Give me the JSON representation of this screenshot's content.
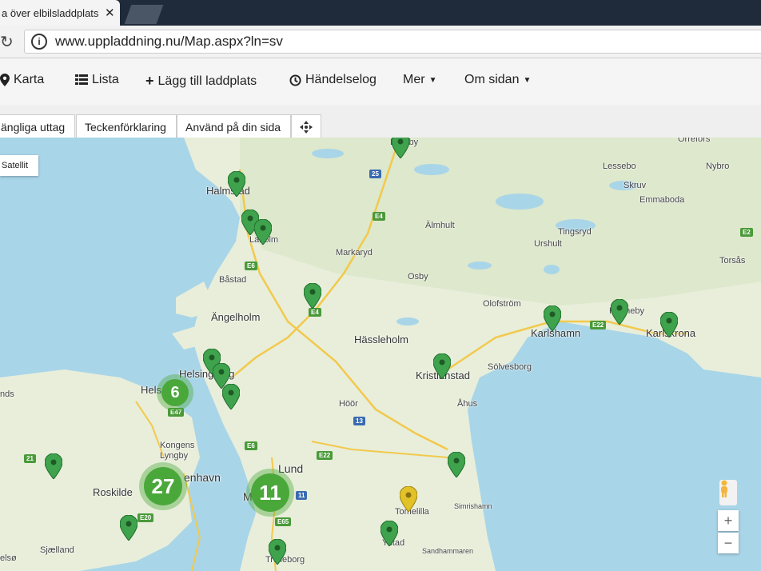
{
  "browser": {
    "tab_title": "a över elbilsladdplats",
    "tab_close": "✕",
    "url": "www.uppladdning.nu/Map.aspx?ln=sv"
  },
  "nav": {
    "karta": "Karta",
    "lista": "Lista",
    "lagg_till": "Lägg till laddplats",
    "handelselog": "Händelselog",
    "mer": "Mer",
    "om_sidan": "Om sidan"
  },
  "toolbar": {
    "uttag": "ängliga uttag",
    "teckenforklaring": "Teckenförklaring",
    "anvand": "Använd på din sida"
  },
  "map": {
    "satellite_label": "Satellit",
    "zoom_in": "+",
    "zoom_out": "−",
    "places": {
      "halmstad": "Halmstad",
      "laholm": "Laholm",
      "bastad": "Båstad",
      "angelholm": "Ängelholm",
      "helsingborg": "Helsingborg",
      "hels": "Hels",
      "markaryd": "Markaryd",
      "almhult": "Älmhult",
      "osby": "Osby",
      "hassleholm": "Hässleholm",
      "kristianstad": "Kristianstad",
      "solvesborg": "Sölvesborg",
      "olofstrom": "Olofström",
      "karlshamn": "Karlshamn",
      "ronneby": "Ronneby",
      "karlskrona": "Karlskrona",
      "tingsryd": "Tingsryd",
      "urshult": "Urshult",
      "lessebo": "Lessebo",
      "nybro": "Nybro",
      "orrefors": "Orrefors",
      "skruv": "Skruv",
      "emmaboda": "Emmaboda",
      "torsas": "Torsås",
      "lyngby_top": "Lyngby",
      "hoor": "Höör",
      "ahus": "Åhus",
      "kongens_lyngby": "Kongens Lyngby",
      "kobenhavn": "enhavn",
      "roskilde": "Roskilde",
      "lund": "Lund",
      "malmo": "M",
      "trelleborg": "Trelleborg",
      "ystad": "Ystad",
      "tomelilla": "Tomelilla",
      "simrishamn": "Simrishamn",
      "sandhammaren": "Sandhammaren",
      "sjaelland": "Sjælland",
      "nds": "nds",
      "slagelse": "elsø"
    },
    "roads": {
      "r25": "25",
      "e4a": "E4",
      "e6a": "E6",
      "e4b": "E4",
      "e22a": "E22",
      "e22b": "E22",
      "e47": "E47",
      "r13": "13",
      "e6b": "E6",
      "e22c": "E22",
      "r11": "11",
      "e65": "E65",
      "r21": "21",
      "e20": "E20",
      "e22d": "E2"
    },
    "clusters": {
      "helsingborg_count": "6",
      "copenhagen_count": "27",
      "malmo_count": "11"
    },
    "colors": {
      "marker_green": "#3fa34d",
      "marker_yellow": "#e2c229",
      "cluster_green": "#4aa83a",
      "water": "#a9d5e8",
      "land": "#e9eeda"
    }
  }
}
